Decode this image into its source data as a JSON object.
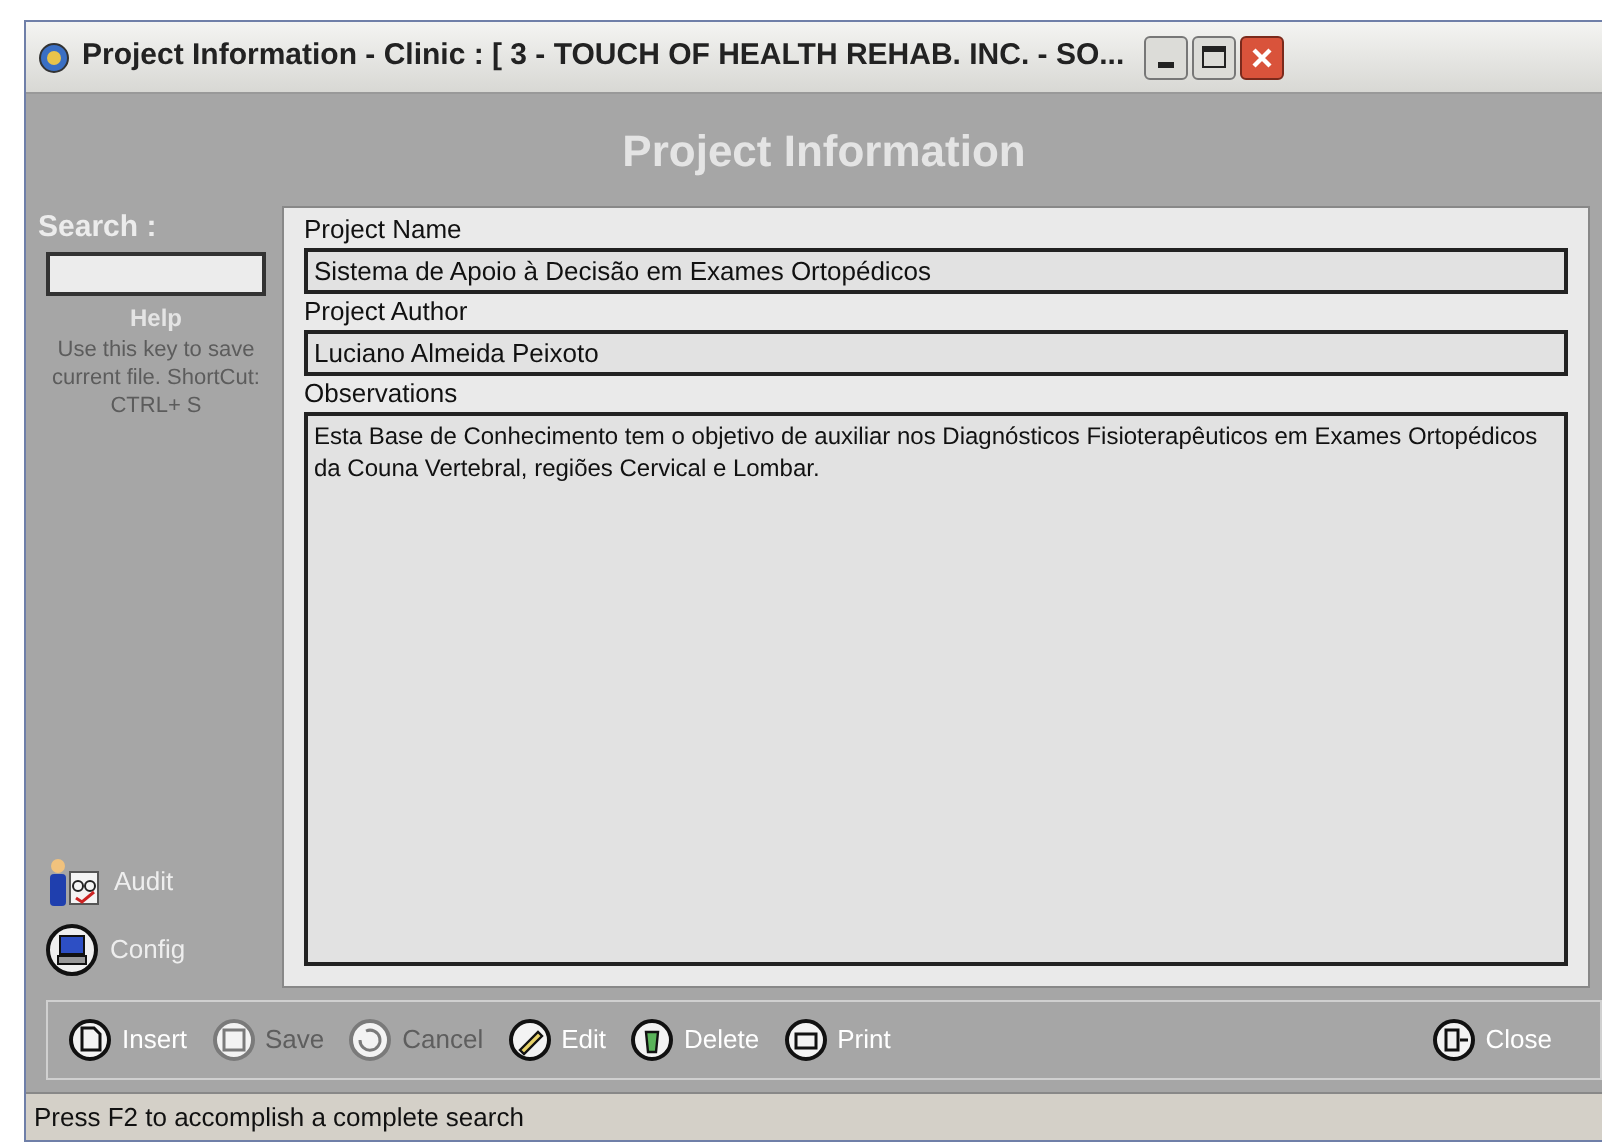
{
  "window": {
    "title": "Project Information - Clinic : [ 3 - TOUCH OF HEALTH REHAB. INC. - SO..."
  },
  "header": "Project Information",
  "sidebar": {
    "search_label": "Search :",
    "help_title": "Help",
    "help_text": "Use this key to save current file. ShortCut: CTRL+ S",
    "links": [
      {
        "label": "Audit",
        "kind": "audit"
      },
      {
        "label": "Config",
        "kind": "config"
      }
    ]
  },
  "fields": [
    {
      "label": "Project Name",
      "value": "Sistema de Apoio à Decisão em Exames Ortopédicos",
      "kind": "line"
    },
    {
      "label": "Project Author",
      "value": "Luciano Almeida Peixoto",
      "kind": "line"
    },
    {
      "label": "Observations",
      "value": "Esta Base de Conhecimento tem o objetivo de auxiliar nos Diagnósticos Fisioterapêuticos em Exames Ortopédicos da Couna Vertebral, regiões Cervical e Lombar.",
      "kind": "memo"
    }
  ],
  "toolbar": [
    {
      "label": "Insert",
      "disabled": false,
      "kind": "insert"
    },
    {
      "label": "Save",
      "disabled": true,
      "kind": "save"
    },
    {
      "label": "Cancel",
      "disabled": true,
      "kind": "cancel"
    },
    {
      "label": "Edit",
      "disabled": false,
      "kind": "edit"
    },
    {
      "label": "Delete",
      "disabled": false,
      "kind": "delete"
    },
    {
      "label": "Print",
      "disabled": false,
      "kind": "print"
    },
    {
      "label": "Close",
      "disabled": false,
      "kind": "close"
    }
  ],
  "status_bar": "Press F2 to accomplish a complete search"
}
